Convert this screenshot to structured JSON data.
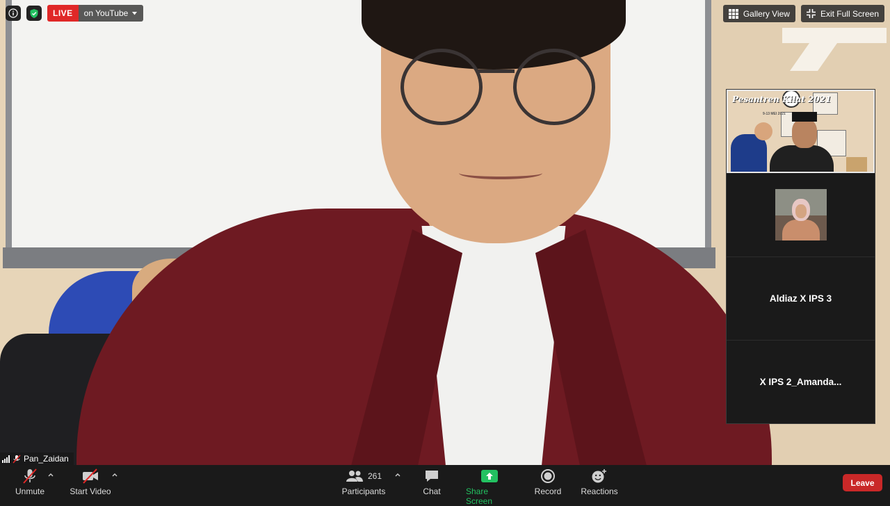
{
  "live": {
    "badge": "LIVE",
    "destination": "on YouTube"
  },
  "view_controls": {
    "gallery_view": "Gallery View",
    "exit_full_screen": "Exit Full Screen"
  },
  "participants_strip": {
    "tile1_poster_title": "Pesantren Kilat 2021",
    "tile1_poster_subtitle": "9-13 MEI 2021",
    "tile3_name": "Aldiaz X IPS 3",
    "tile4_name": "X IPS  2_Amanda..."
  },
  "active_speaker": {
    "name": "Pan_Zaidan"
  },
  "toolbar": {
    "unmute": "Unmute",
    "start_video": "Start Video",
    "participants": "Participants",
    "participants_count": "261",
    "chat": "Chat",
    "share_screen": "Share Screen",
    "record": "Record",
    "reactions": "Reactions",
    "leave": "Leave"
  },
  "colors": {
    "live_red": "#e02828",
    "share_green": "#23c161",
    "leave_red": "#c92828"
  },
  "icons": [
    "info-icon",
    "shield-icon",
    "caret-down-icon",
    "grid-icon",
    "shrink-icon",
    "signal-icon",
    "muted-mic-icon",
    "video-off-icon",
    "participants-icon",
    "chat-icon",
    "share-screen-icon",
    "record-icon",
    "reactions-icon"
  ]
}
